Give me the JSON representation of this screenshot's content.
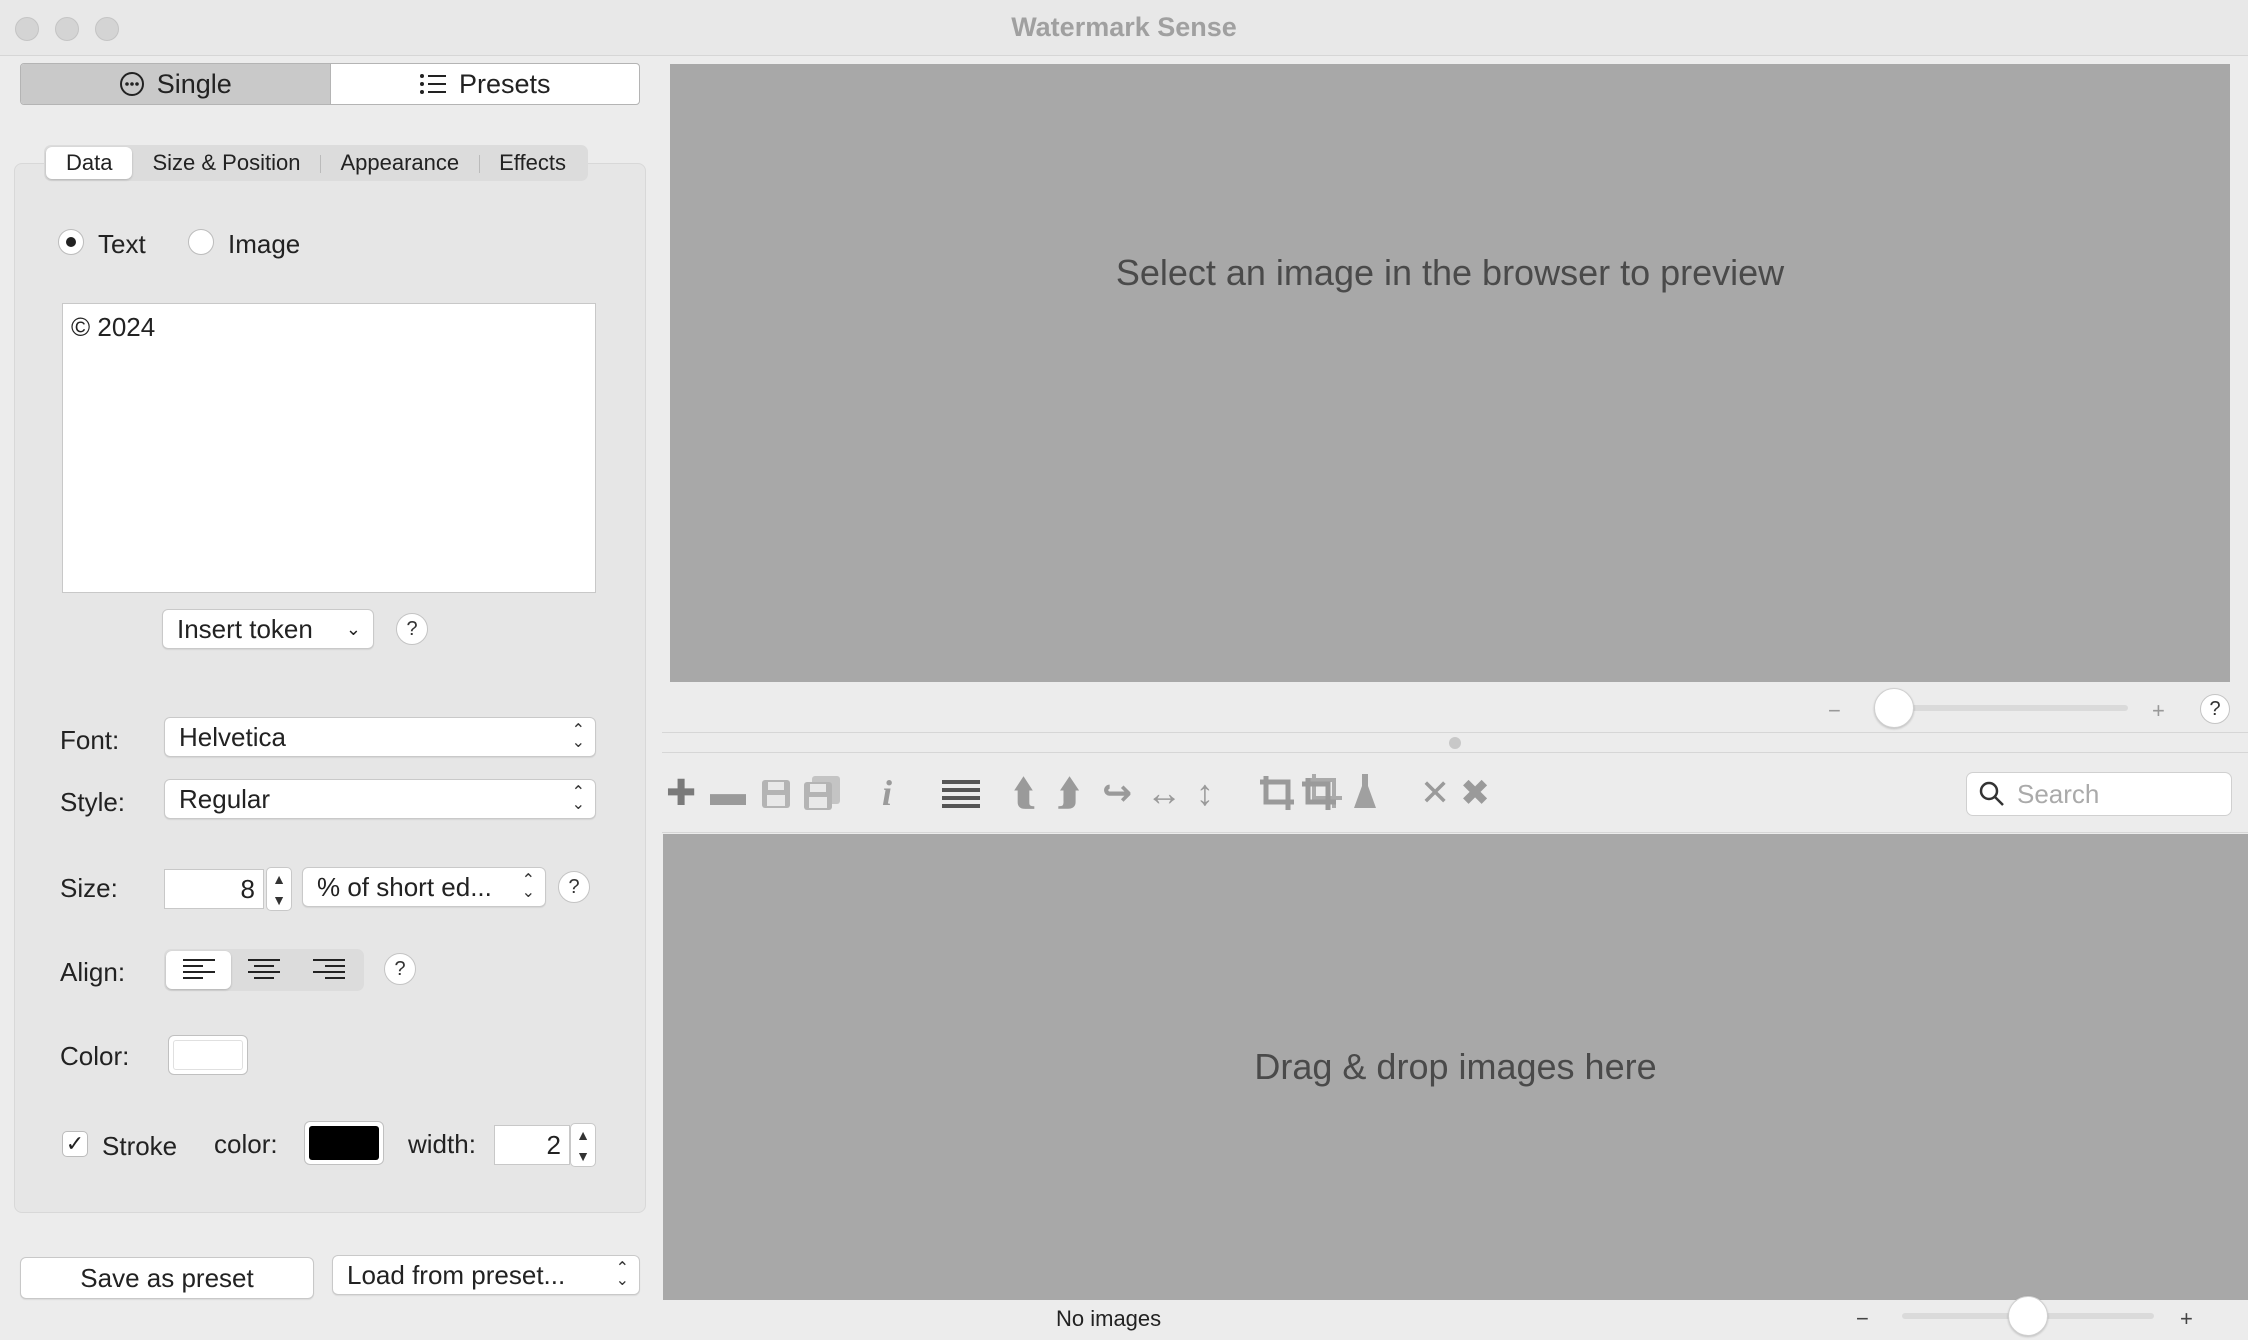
{
  "window": {
    "title": "Watermark Sense"
  },
  "mode": {
    "single_label": "Single",
    "presets_label": "Presets"
  },
  "tabs": [
    "Data",
    "Size & Position",
    "Appearance",
    "Effects"
  ],
  "source": {
    "text_label": "Text",
    "image_label": "Image",
    "selected": "Text"
  },
  "watermark_text": "© 2024",
  "insert_token": {
    "label": "Insert token",
    "help": "?"
  },
  "font": {
    "label": "Font:",
    "value": "Helvetica"
  },
  "style": {
    "label": "Style:",
    "value": "Regular"
  },
  "size": {
    "label": "Size:",
    "value": "8",
    "unit": "% of short ed...",
    "help": "?"
  },
  "align": {
    "label": "Align:",
    "selected": "left",
    "help": "?"
  },
  "color": {
    "label": "Color:",
    "value": "#ffffff"
  },
  "stroke": {
    "checked": true,
    "check_glyph": "✓",
    "label": "Stroke",
    "color_label": "color:",
    "color": "#000000",
    "width_label": "width:",
    "width": "2"
  },
  "footer": {
    "save_preset": "Save as preset",
    "load_preset": "Load from preset..."
  },
  "preview": {
    "placeholder": "Select an image in the browser to preview",
    "help": "?",
    "zoom_min": "−",
    "zoom_max": "+",
    "zoom_level": 0.0
  },
  "toolbar": {
    "icons": [
      "add-icon",
      "remove-icon",
      "save-icon",
      "save-all-icon",
      "info-icon",
      "list-icon",
      "rotate-left-icon",
      "rotate-right-icon",
      "rotate-icon",
      "flip-horizontal-icon",
      "flip-vertical-icon",
      "crop-icon",
      "crop-all-icon",
      "clear-icon",
      "close-icon",
      "close-all-icon"
    ],
    "search_placeholder": "Search"
  },
  "browser": {
    "placeholder": "Drag & drop images here",
    "zoom_min": "−",
    "zoom_max": "+",
    "zoom_level": 0.5
  },
  "status": {
    "text": "No images"
  }
}
